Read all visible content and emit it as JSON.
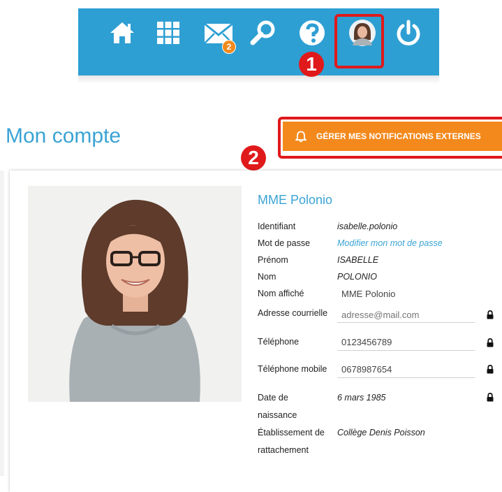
{
  "topbar": {
    "icons": [
      "home-icon",
      "apps-grid-icon",
      "mail-icon",
      "search-icon",
      "help-icon",
      "avatar",
      "power-icon"
    ],
    "mail_badge": "2",
    "color": "#2e9fd3"
  },
  "annotations": {
    "marker1": "1",
    "marker2": "2",
    "color": "#e0191b"
  },
  "page": {
    "title": "Mon compte",
    "notif_button": "GÉRER MES NOTIFICATIONS EXTERNES"
  },
  "profile": {
    "name": "MME Polonio",
    "labels": {
      "identifiant": "Identifiant",
      "password": "Mot de passe",
      "prenom": "Prénom",
      "nom": "Nom",
      "nom_affiche": "Nom affiché",
      "email": "Adresse courrielle",
      "telephone": "Téléphone",
      "mobile": "Téléphone mobile",
      "dob_1": "Date de",
      "dob_2": "naissance",
      "etab_1": "Établissement de",
      "etab_2": "rattachement"
    },
    "values": {
      "identifiant": "isabelle.polonio",
      "password_link": "Modifier mon mot de passe",
      "prenom": "ISABELLE",
      "nom": "POLONIO",
      "nom_affiche": "MME Polonio",
      "email_placeholder": "adresse@mail.com",
      "telephone": "0123456789",
      "mobile": "0678987654",
      "dob": "6 mars 1985",
      "etablissement": "Collège Denis Poisson"
    }
  },
  "colors": {
    "accent": "#3aa3d4",
    "orange": "#f3891c"
  }
}
